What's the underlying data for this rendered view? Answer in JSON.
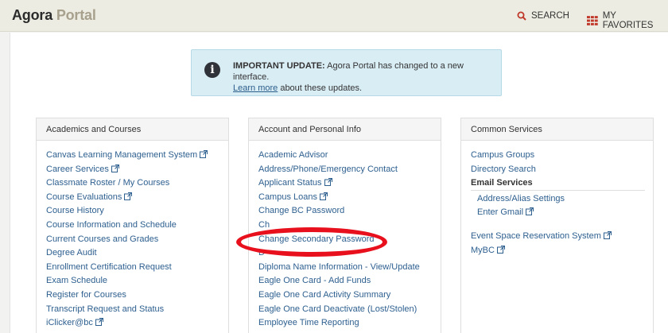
{
  "header": {
    "brand_main": "Agora",
    "brand_sub": "Portal",
    "search_label": "SEARCH",
    "favorites_label": "MY FAVORITES",
    "search_color": "#c0392b",
    "favorites_color": "#c0392b"
  },
  "notice": {
    "bold_text": "IMPORTANT UPDATE:",
    "text": " Agora Portal has changed to a new interface.",
    "link_text": "Learn more",
    "link_suffix": " about these updates.",
    "icon": "info-icon"
  },
  "panels": [
    {
      "title": "Academics and Courses",
      "items": [
        {
          "label": "Canvas Learning Management System",
          "external": true
        },
        {
          "label": "Career Services",
          "external": true
        },
        {
          "label": "Classmate Roster / My Courses",
          "external": false
        },
        {
          "label": "Course Evaluations",
          "external": true
        },
        {
          "label": "Course History",
          "external": false
        },
        {
          "label": "Course Information and Schedule",
          "external": false
        },
        {
          "label": "Current Courses and Grades",
          "external": false
        },
        {
          "label": "Degree Audit",
          "external": false
        },
        {
          "label": "Enrollment Certification Request",
          "external": false
        },
        {
          "label": "Exam Schedule",
          "external": false
        },
        {
          "label": "Register for Courses",
          "external": false
        },
        {
          "label": "Transcript Request and Status",
          "external": false
        },
        {
          "label": "iClicker@bc",
          "external": true
        }
      ]
    },
    {
      "title": "Account and Personal Info",
      "items": [
        {
          "label": "Academic Advisor",
          "external": false
        },
        {
          "label": "Address/Phone/Emergency Contact",
          "external": false
        },
        {
          "label": "Applicant Status",
          "external": true
        },
        {
          "label": "Campus Loans",
          "external": true
        },
        {
          "label": "Change BC Password",
          "external": false
        },
        {
          "label": "Ch",
          "external": false
        },
        {
          "label": "Change Secondary Password",
          "external": false
        },
        {
          "label": "D",
          "external": false
        },
        {
          "label": "Diploma Name Information - View/Update",
          "external": false
        },
        {
          "label": "Eagle One Card - Add Funds",
          "external": false
        },
        {
          "label": "Eagle One Card Activity Summary",
          "external": false
        },
        {
          "label": "Eagle One Card Deactivate (Lost/Stolen)",
          "external": false
        },
        {
          "label": "Employee Time Reporting",
          "external": false
        }
      ]
    },
    {
      "title": "Common Services",
      "items": [
        {
          "label": "Campus Groups",
          "external": false
        },
        {
          "label": "Directory Search",
          "external": false
        },
        {
          "label": "Email Services",
          "heading": true
        },
        {
          "label": "Address/Alias Settings",
          "sub": true
        },
        {
          "label": "Enter Gmail",
          "sub": true,
          "external": true
        },
        {
          "spacer": true
        },
        {
          "label": "Event Space Reservation System",
          "external": true
        },
        {
          "label": "MyBC",
          "external": true
        }
      ]
    }
  ]
}
